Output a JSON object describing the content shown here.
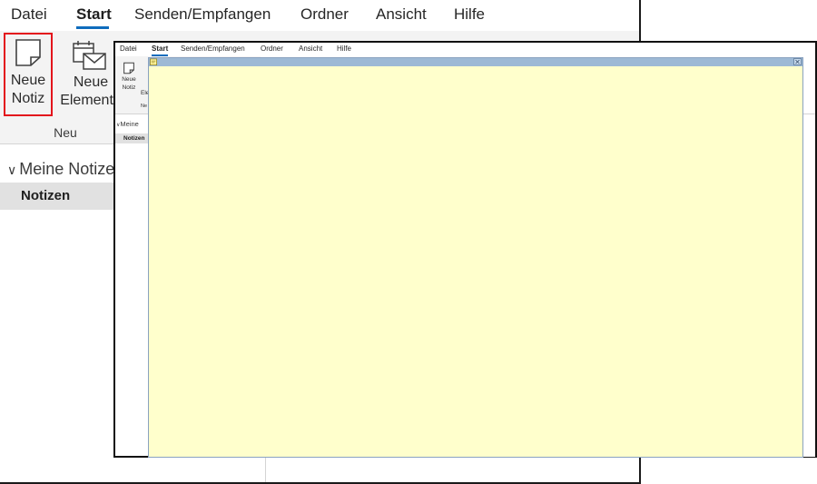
{
  "background_window": {
    "tabs": [
      "Datei",
      "Start",
      "Senden/Empfangen",
      "Ordner",
      "Ansicht",
      "Hilfe"
    ],
    "active_tab": "Start",
    "ribbon": {
      "new_note_line1": "Neue",
      "new_note_line2": "Notiz",
      "new_items_line1": "Neue",
      "new_items_line2": "Elemente",
      "group_label": "Neu"
    },
    "nav": {
      "header": "Meine Notizen",
      "item": "Notizen"
    }
  },
  "foreground_window": {
    "tabs": [
      "Datei",
      "Start",
      "Senden/Empfangen",
      "Ordner",
      "Ansicht",
      "Hilfe"
    ],
    "ribbon": {
      "new_note_line1": "Neue",
      "new_note_line2": "Notiz",
      "new_items_fragment": "Ele",
      "group_fragment": "Ne"
    },
    "nav": {
      "header": "Meine",
      "item": "Notizen"
    }
  },
  "sticky_note": {
    "close_glyph": "✕",
    "background_color": "#ffffcc",
    "titlebar_color": "#9db9d5"
  },
  "colors": {
    "accent": "#0f6cbd",
    "highlight_border": "#e3141c"
  }
}
